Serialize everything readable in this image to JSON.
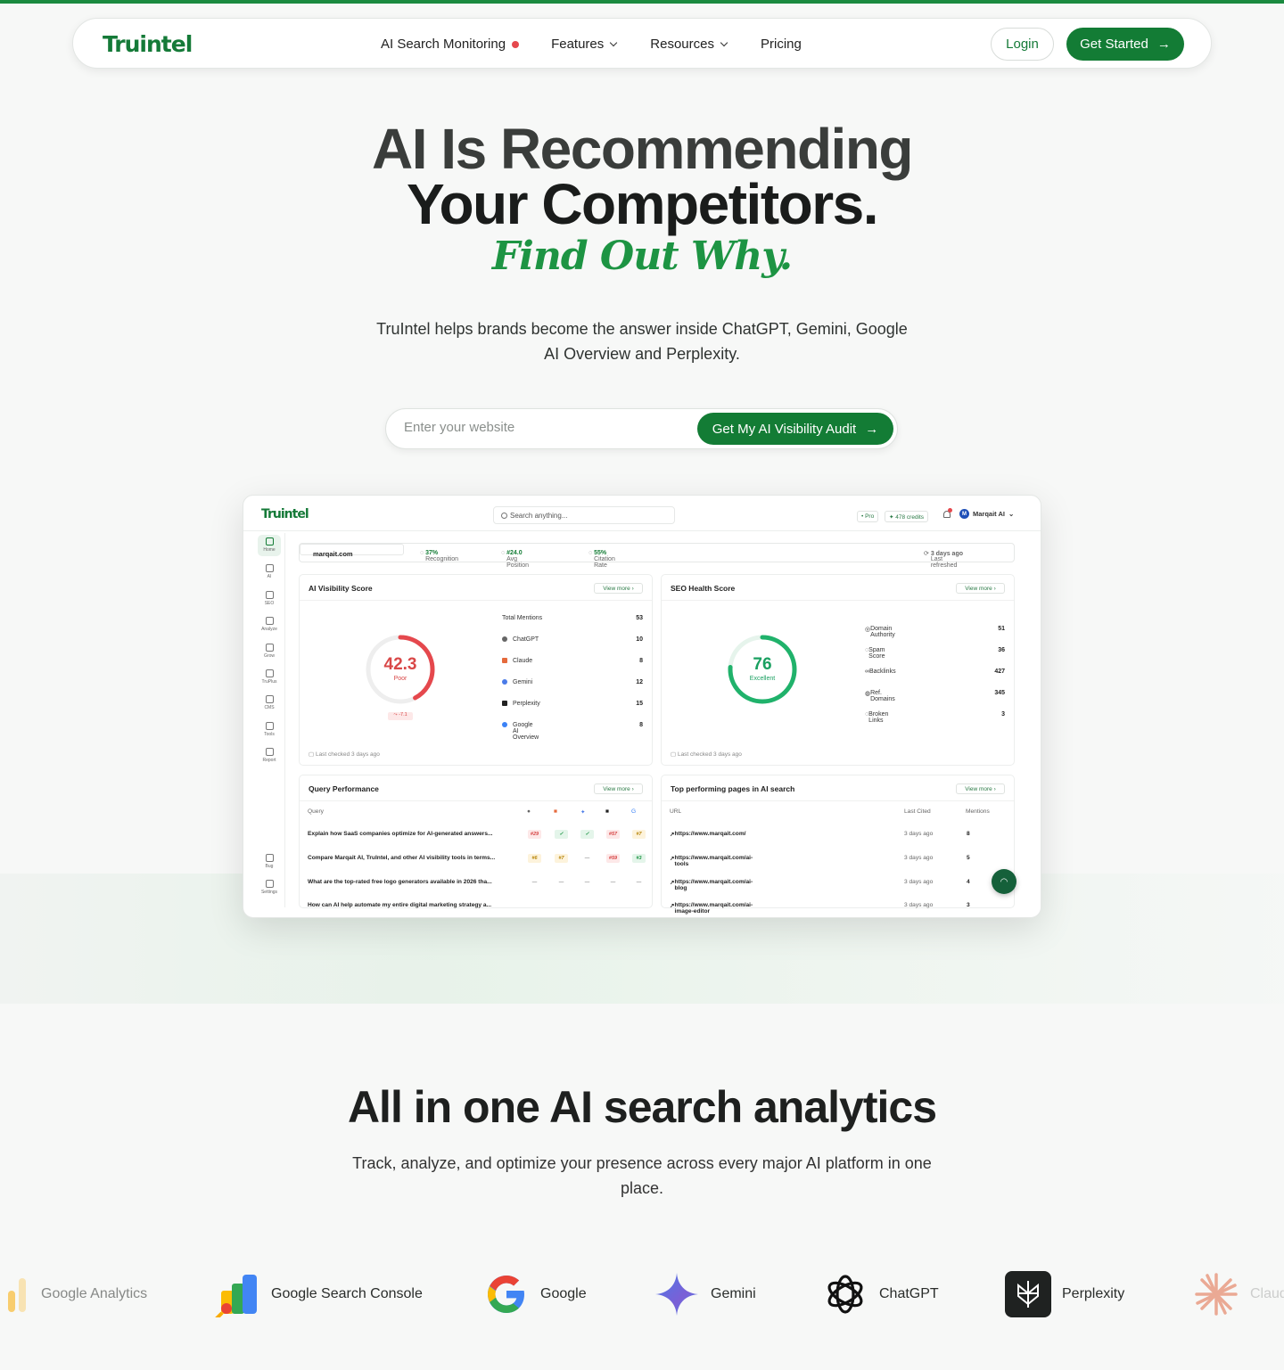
{
  "nav": {
    "logo": "Truintel",
    "links": [
      "AI Search Monitoring",
      "Features",
      "Resources",
      "Pricing"
    ],
    "login": "Login",
    "get_started": "Get Started"
  },
  "hero": {
    "line1": "AI Is Recommending",
    "line2": "Your Competitors.",
    "line3": "Find Out Why.",
    "subtitle": "TruIntel helps brands become the answer inside ChatGPT, Gemini, Google AI Overview and Perplexity.",
    "input_placeholder": "Enter your website",
    "cta": "Get My AI Visibility Audit"
  },
  "dashboard": {
    "logo": "Truintel",
    "search_placeholder": "Search anything...",
    "plan": "Pro",
    "credits": "478 credits",
    "user": "Marqait AI",
    "user_initial": "M",
    "sidebar": [
      "Home",
      "AI",
      "SEO",
      "Analyze",
      "Grow",
      "TruPlus",
      "CMS",
      "Tools",
      "Report",
      "Bug",
      "Settings"
    ],
    "domain": "marqait.com",
    "recognition_label": "Recognition",
    "recognition_value": "37%",
    "avg_position_label": "Avg Position",
    "avg_position_value": "#24.0",
    "citation_rate_label": "Citation Rate",
    "citation_rate_value": "55%",
    "last_refreshed_label": "Last refreshed",
    "last_refreshed_value": "3 days ago",
    "view_more": "View more",
    "ai_visibility": {
      "title": "AI Visibility Score",
      "score": "42.3",
      "score_fraction": 0.423,
      "rating": "Poor",
      "delta": "-7.1",
      "total_label": "Total Mentions",
      "total_value": "53",
      "rows": [
        {
          "label": "ChatGPT",
          "value": "10"
        },
        {
          "label": "Claude",
          "value": "8"
        },
        {
          "label": "Gemini",
          "value": "12"
        },
        {
          "label": "Perplexity",
          "value": "15"
        },
        {
          "label": "Google AI Overview",
          "value": "8"
        }
      ],
      "footer": "Last checked 3 days ago"
    },
    "seo_health": {
      "title": "SEO Health Score",
      "score": "76",
      "score_fraction": 0.76,
      "rating": "Excellent",
      "rows": [
        {
          "label": "Domain Authority",
          "value": "51"
        },
        {
          "label": "Spam Score",
          "value": "36"
        },
        {
          "label": "Backlinks",
          "value": "427"
        },
        {
          "label": "Ref. Domains",
          "value": "345"
        },
        {
          "label": "Broken Links",
          "value": "3"
        }
      ],
      "footer": "Last checked 3 days ago"
    },
    "query_performance": {
      "title": "Query Performance",
      "col_query": "Query",
      "rows": [
        {
          "q": "Explain how SaaS companies optimize for AI-generated answers...",
          "b": [
            "#29",
            "✓",
            "✓",
            "#57",
            "#7"
          ],
          "t": [
            "r",
            "g",
            "g",
            "r",
            "y"
          ]
        },
        {
          "q": "Compare Marqait AI, TruIntel, and other AI visibility tools in terms...",
          "b": [
            "#6",
            "#7",
            "—",
            "#59",
            "#3"
          ],
          "t": [
            "y",
            "y",
            "n",
            "r",
            "g"
          ]
        },
        {
          "q": "What are the top-rated free logo generators available in 2026 tha...",
          "b": [
            "—",
            "—",
            "—",
            "—",
            "—"
          ],
          "t": [
            "n",
            "n",
            "n",
            "n",
            "n"
          ]
        },
        {
          "q": "How can AI help automate my entire digital marketing strategy a...",
          "b": [],
          "t": []
        }
      ]
    },
    "top_pages": {
      "title": "Top performing pages in AI search",
      "col_url": "URL",
      "col_cited": "Last Cited",
      "col_mentions": "Mentions",
      "rows": [
        {
          "url": "https://www.marqait.com/",
          "cited": "3 days ago",
          "m": "8"
        },
        {
          "url": "https://www.marqait.com/ai-tools",
          "cited": "3 days ago",
          "m": "5"
        },
        {
          "url": "https://www.marqait.com/ai-blog",
          "cited": "3 days ago",
          "m": "4"
        },
        {
          "url": "https://www.marqait.com/ai-image-editor",
          "cited": "3 days ago",
          "m": "3"
        }
      ]
    }
  },
  "section2": {
    "title": "All in one AI search analytics",
    "subtitle": "Track, analyze, and optimize your presence across every major AI platform in one place."
  },
  "integrations": [
    "Google Analytics",
    "Google Search Console",
    "Google",
    "Gemini",
    "ChatGPT",
    "Perplexity",
    "Claude"
  ],
  "colors": {
    "brand": "#137c35",
    "accent_green": "#1d9443",
    "poor_red": "#e5484d",
    "excellent_green": "#20b26b"
  }
}
